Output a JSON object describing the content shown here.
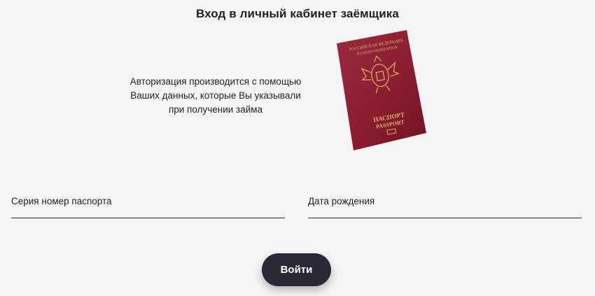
{
  "page": {
    "title": "Вход в личный кабинет заёмщика",
    "info_lines": [
      "Авторизация производится с помощью",
      "Ваших данных, которые Вы указывали",
      "при получении займа"
    ]
  },
  "passport_image": {
    "icon": "passport-icon",
    "top_text_ru": "РОССИЙСКАЯ ФЕДЕРАЦИЯ",
    "top_text_en": "RUSSIAN FEDERATION",
    "bottom_text_ru": "ПАСПОРТ",
    "bottom_text_en": "PASSPORT",
    "cover_color": "#8e1f33",
    "emblem_color": "#d8b26a"
  },
  "form": {
    "passport_label": "Серия номер паспорта",
    "birthdate_label": "Дата рождения",
    "submit_label": "Войти"
  },
  "colors": {
    "background": "#f5f5f5",
    "button": "#2b2937",
    "text": "#1f1f24"
  }
}
